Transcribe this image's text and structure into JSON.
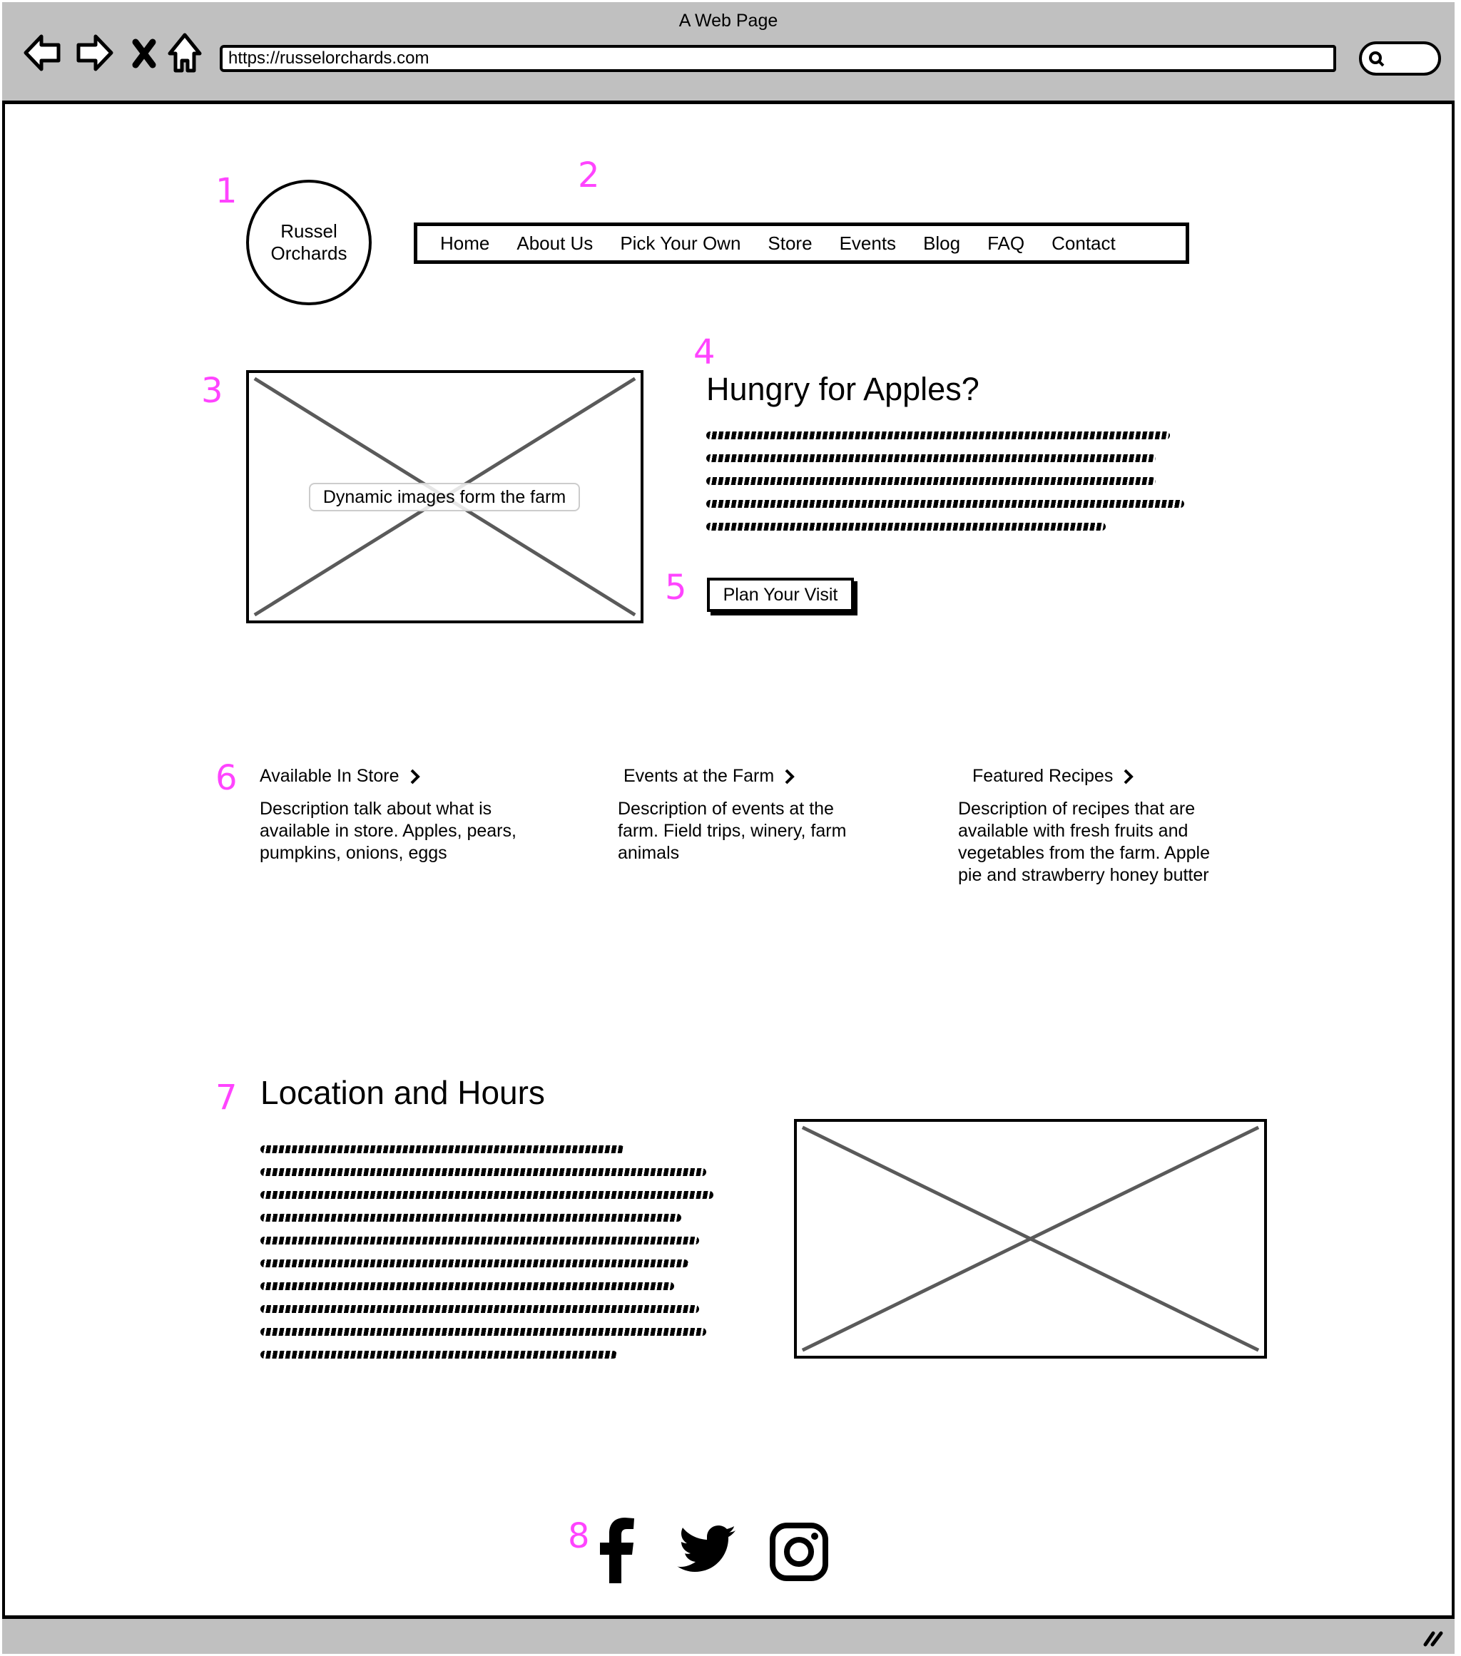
{
  "browser": {
    "window_title": "A Web Page",
    "url": "https://russelorchards.com",
    "icons": [
      "back-arrow-icon",
      "forward-arrow-icon",
      "close-x-icon",
      "home-icon",
      "search-icon",
      "resize-grip-icon"
    ]
  },
  "annotations": [
    "1",
    "2",
    "3",
    "4",
    "5",
    "6",
    "7",
    "8"
  ],
  "logo": {
    "line1": "Russel",
    "line2": "Orchards"
  },
  "nav": {
    "items": [
      "Home",
      "About Us",
      "Pick Your Own",
      "Store",
      "Events",
      "Blog",
      "FAQ",
      "Contact"
    ]
  },
  "hero": {
    "image_caption": "Dynamic images form the farm",
    "heading": "Hungry for Apples?",
    "body_placeholder_lines": 5,
    "cta_label": "Plan Your Visit"
  },
  "cards": [
    {
      "title": "Available In Store",
      "icon": "chevron-right-icon",
      "description": "Description talk about what is available in store. Apples, pears, pumpkins, onions, eggs"
    },
    {
      "title": "Events at the Farm",
      "icon": "chevron-right-icon",
      "description": "Description of events at the farm. Field trips, winery, farm animals"
    },
    {
      "title": "Featured Recipes",
      "icon": "chevron-right-icon",
      "description": "Description of recipes that are available with fresh fruits and vegetables from the farm. Apple pie and strawberry honey butter"
    }
  ],
  "location": {
    "heading": "Location and Hours",
    "body_placeholder_lines": 10
  },
  "social": [
    {
      "name": "facebook",
      "icon": "facebook-icon"
    },
    {
      "name": "twitter",
      "icon": "twitter-icon"
    },
    {
      "name": "instagram",
      "icon": "instagram-icon"
    }
  ],
  "colors": {
    "chrome": "#c0c0c0",
    "annotation": "#ff44ff",
    "placeholder_x": "#5a5a5a"
  }
}
